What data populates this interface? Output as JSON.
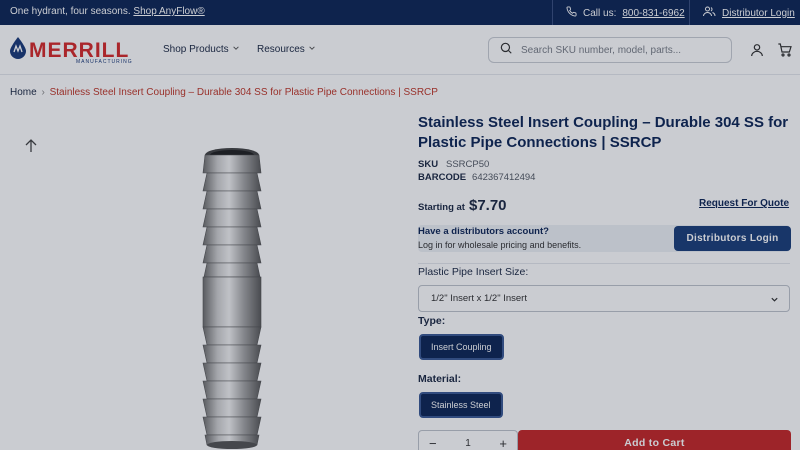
{
  "announcement": {
    "text": "One hydrant, four seasons.",
    "link": "Shop AnyFlow®",
    "call_label": "Call us:",
    "phone": "800-831-6962",
    "login_link": "Distributor Login"
  },
  "header": {
    "logo_text": "MERRILL",
    "logo_sub": "MANUFACTURING",
    "nav": [
      "Shop Products",
      "Resources"
    ],
    "search_placeholder": "Search SKU number, model, parts..."
  },
  "breadcrumb": {
    "home": "Home",
    "separator": "›",
    "current": "Stainless Steel Insert Coupling – Durable 304 SS for Plastic Pipe Connections | SSRCP"
  },
  "product": {
    "title": "Stainless Steel Insert Coupling – Durable 304 SS for Plastic Pipe Connections | SSRCP",
    "sku_label": "SKU",
    "sku": "SSRCP50",
    "barcode_label": "BARCODE",
    "barcode": "642367412494",
    "starting_at_label": "Starting at",
    "price": "$7.70",
    "request_quote": "Request For Quote",
    "distributor_heading": "Have a distributors account?",
    "distributor_sub": "Log in for wholesale pricing and benefits.",
    "distributor_button": "Distributors Login",
    "size_label": "Plastic Pipe Insert Size:",
    "size_value": "1/2\" Insert x 1/2\" Insert",
    "type_label": "Type:",
    "type_value": "Insert Coupling",
    "material_label": "Material:",
    "material_value": "Stainless Steel",
    "quantity": "1",
    "add_to_cart": "Add to Cart"
  },
  "colors": {
    "navy": "#0f2757",
    "brand_red": "#d62b2b",
    "button_blue": "#1b3f7a",
    "cart_red": "#c62828"
  }
}
